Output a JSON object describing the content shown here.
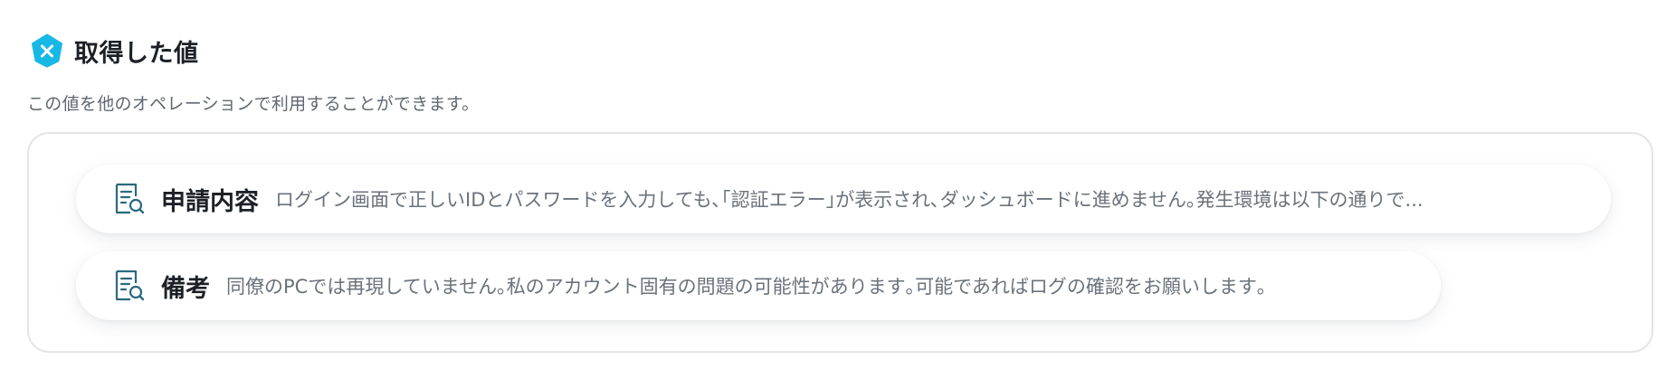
{
  "section": {
    "title": "取得した値",
    "description": "この値を他のオペレーションで利用することができます。",
    "badge_icon": "variable-x-icon",
    "accent_color": "#17b8e6"
  },
  "fields": [
    {
      "icon": "document-search-icon",
      "label": "申請内容",
      "value": "ログイン画面で正しいIDとパスワードを入力しても､｢認証エラー｣が表示され､ダッシュボードに進めません｡発生環境は以下の通りで..."
    },
    {
      "icon": "document-search-icon",
      "label": "備考",
      "value": "同僚のPCでは再現していません｡私のアカウント固有の問題の可能性があります｡可能であればログの確認をお願いします｡"
    }
  ],
  "colors": {
    "icon_stroke": "#2a6a7e",
    "border": "#e3e5e8",
    "value_text": "#6a727b"
  }
}
